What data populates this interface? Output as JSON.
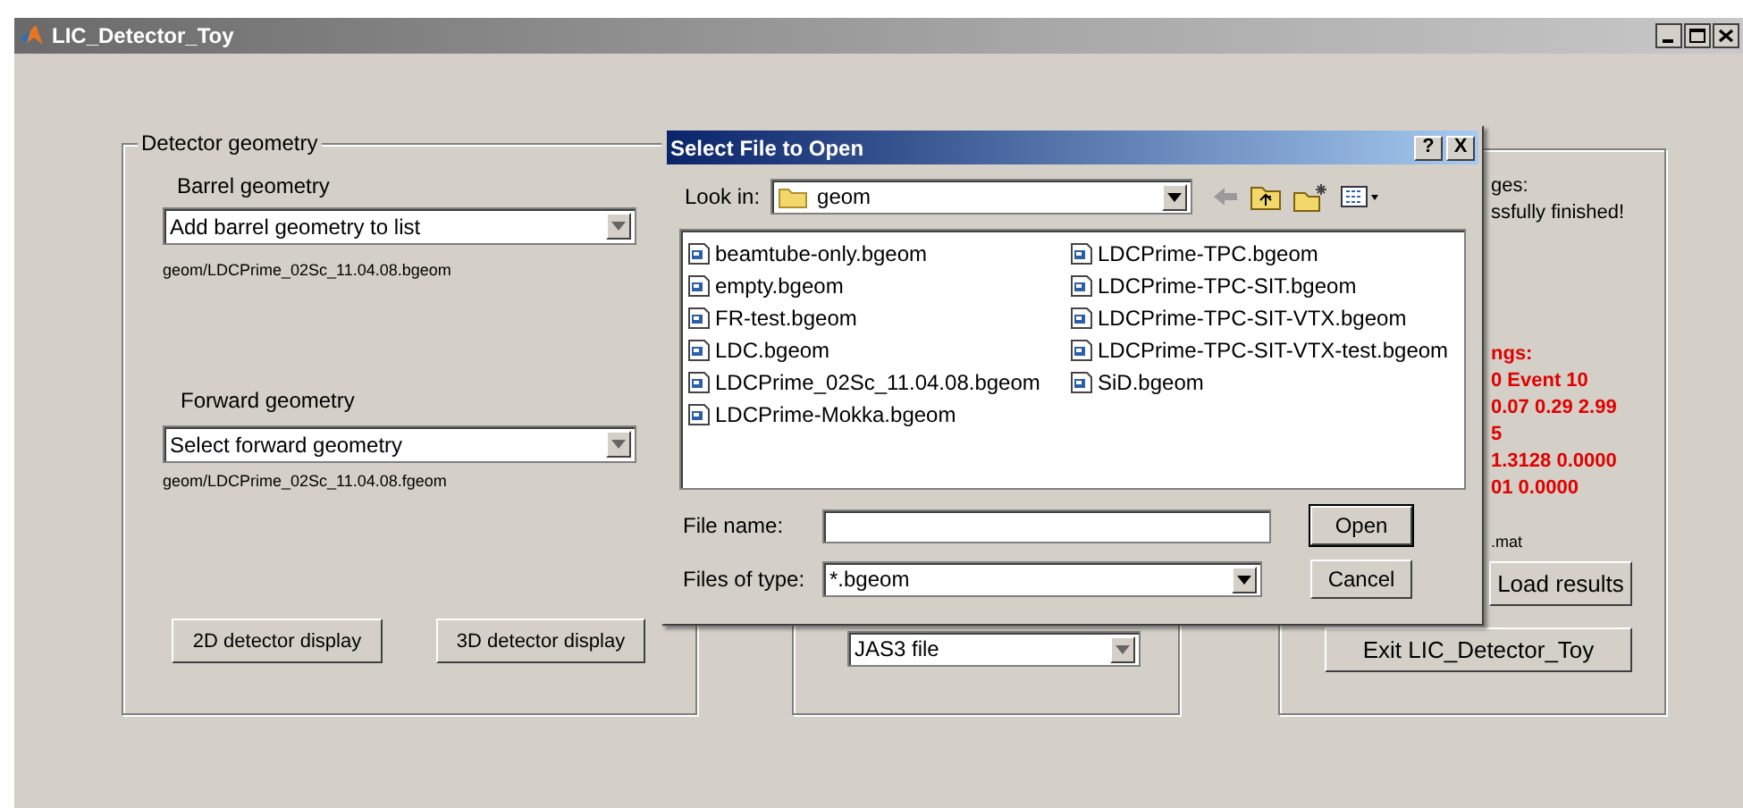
{
  "window": {
    "title": "LIC_Detector_Toy"
  },
  "detector_geometry": {
    "title": "Detector geometry",
    "barrel": {
      "label": "Barrel geometry",
      "value": "Add barrel geometry to list",
      "path": "geom/LDCPrime_02Sc_11.04.08.bgeom"
    },
    "forward": {
      "label": "Forward geometry",
      "value": "Select forward geometry",
      "path": "geom/LDCPrime_02Sc_11.04.08.fgeom"
    },
    "buttons": [
      "2D detector display",
      "3D detector display"
    ]
  },
  "output_panel": {
    "format_value": "JAS3 file"
  },
  "messages_panel": {
    "lines": [
      {
        "text": "ges:",
        "kind": "normal"
      },
      {
        "text": "ssfully finished!",
        "kind": "normal"
      },
      {
        "text": "ngs:",
        "kind": "alert"
      },
      {
        "text": "0 Event 10",
        "kind": "alert"
      },
      {
        "text": "0.07 0.29 2.99",
        "kind": "alert"
      },
      {
        "text": "5",
        "kind": "alert"
      },
      {
        "text": "1.3128 0.0000",
        "kind": "alert"
      },
      {
        "text": "01 0.0000",
        "kind": "alert"
      }
    ],
    "file_text": ".mat",
    "buttons": [
      "Load results",
      "Exit LIC_Detector_Toy"
    ]
  },
  "dialog": {
    "title": "Select File to Open",
    "help": "?",
    "close": "X",
    "look_in_label": "Look in:",
    "look_in": "geom",
    "files": [
      "beamtube-only.bgeom",
      "empty.bgeom",
      "FR-test.bgeom",
      "LDC.bgeom",
      "LDCPrime_02Sc_11.04.08.bgeom",
      "LDCPrime-Mokka.bgeom",
      "LDCPrime-TPC.bgeom",
      "LDCPrime-TPC-SIT.bgeom",
      "LDCPrime-TPC-SIT-VTX.bgeom",
      "LDCPrime-TPC-SIT-VTX-test.bgeom",
      "SiD.bgeom"
    ],
    "file_name_label": "File name:",
    "file_type_label": "Files of type:",
    "file_type": "*.bgeom",
    "buttons": [
      "Open",
      "Cancel"
    ]
  }
}
